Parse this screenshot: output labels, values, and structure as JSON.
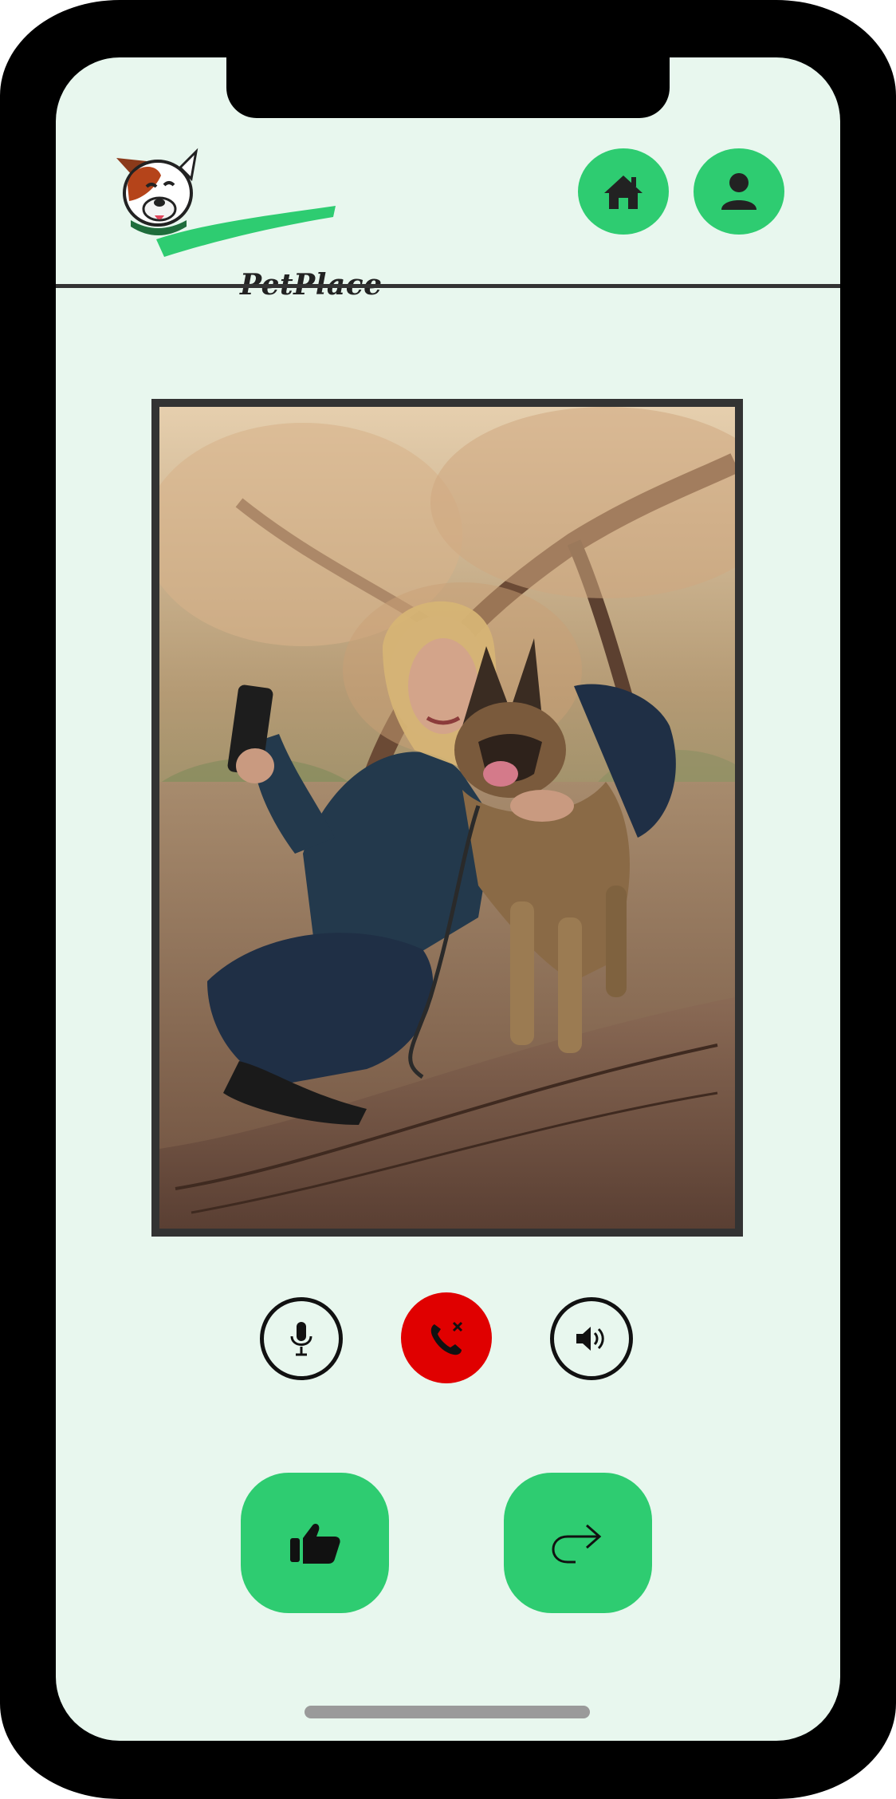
{
  "app": {
    "brand_name": "PetPlace"
  },
  "header": {
    "home_button": {
      "icon": "home-icon"
    },
    "profile_button": {
      "icon": "user-icon"
    }
  },
  "call": {
    "controls": [
      {
        "name": "microphone",
        "icon": "microphone-icon"
      },
      {
        "name": "end-call",
        "icon": "phone-hangup-icon",
        "color": "#e00000"
      },
      {
        "name": "speaker",
        "icon": "speaker-icon"
      }
    ]
  },
  "actions": {
    "like": {
      "icon": "thumbs-up-icon"
    },
    "share": {
      "icon": "share-arrow-icon"
    }
  },
  "colors": {
    "accent": "#2ecc71",
    "background": "#e8f7ee",
    "danger": "#e00000",
    "dark": "#333333"
  }
}
